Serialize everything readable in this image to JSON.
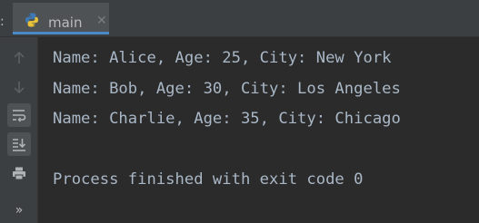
{
  "tabbar": {
    "prefix": ":",
    "tab": {
      "label": "main",
      "icon": "python-icon",
      "close_glyph": "✕",
      "underline_color": "#4a88c7"
    }
  },
  "toolbar": {
    "items": [
      {
        "name": "up-arrow-icon",
        "active": false
      },
      {
        "name": "down-arrow-icon",
        "active": false
      },
      {
        "name": "soft-wrap-icon",
        "active": true
      },
      {
        "name": "scroll-to-end-icon",
        "active": true
      },
      {
        "name": "print-icon",
        "active": false
      },
      {
        "name": "more-icon",
        "glyph": "»",
        "active": false
      }
    ]
  },
  "console": {
    "lines": [
      "Name: Alice, Age: 25, City: New York",
      "Name: Bob, Age: 30, City: Los Angeles",
      "Name: Charlie, Age: 35, City: Chicago",
      "",
      "Process finished with exit code 0"
    ]
  },
  "colors": {
    "background": "#2b2b2b",
    "toolbar": "#3c3f41",
    "text": "#a9b7c6",
    "accent": "#4a88c7"
  }
}
